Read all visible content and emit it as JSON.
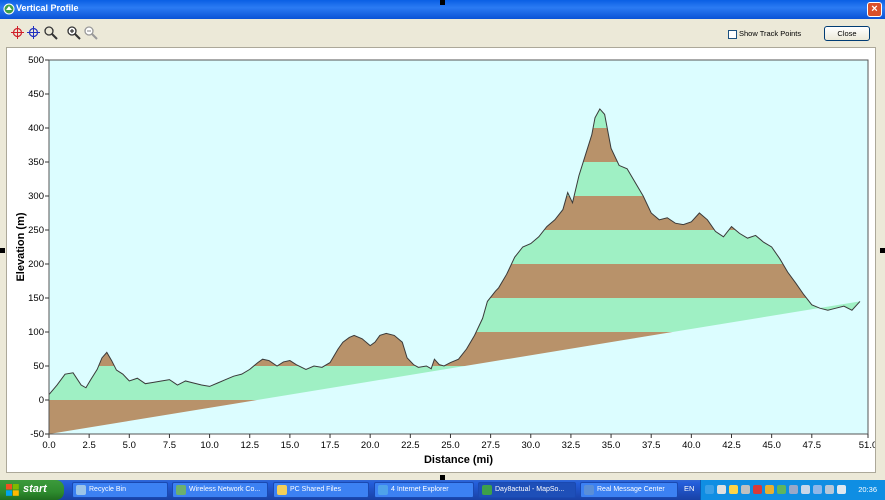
{
  "window": {
    "title": "Vertical Profile"
  },
  "toolbar": {
    "show_track_points_label": "Show Track Points",
    "show_track_points_checked": false,
    "close_label": "Close",
    "tools": [
      "pan-crosshair-icon",
      "center-crosshair-icon",
      "zoom-box-icon",
      "zoom-in-icon",
      "zoom-out-icon"
    ]
  },
  "chart_data": {
    "type": "area",
    "xlabel": "Distance   (mi)",
    "ylabel": "Elevation  (m)",
    "xlim": [
      0,
      51
    ],
    "ylim": [
      -50,
      500
    ],
    "xticks": [
      "0.0",
      "2.5",
      "5.0",
      "7.5",
      "10.0",
      "12.5",
      "15.0",
      "17.5",
      "20.0",
      "22.5",
      "25.0",
      "27.5",
      "30.0",
      "32.5",
      "35.0",
      "37.5",
      "40.0",
      "42.5",
      "45.0",
      "47.5",
      "51.0"
    ],
    "yticks": [
      "-50",
      "0",
      "50",
      "100",
      "150",
      "200",
      "250",
      "300",
      "350",
      "400",
      "450",
      "500"
    ],
    "band_colors": [
      "#b8926a",
      "#9ff0c4"
    ],
    "background": "#dcfdff",
    "line_color": "#3a3a3a",
    "x": [
      0,
      0.5,
      1,
      1.5,
      2,
      2.3,
      2.6,
      3,
      3.3,
      3.6,
      3.9,
      4.2,
      4.6,
      5,
      5.5,
      6,
      6.5,
      7,
      7.5,
      8,
      8.5,
      9,
      9.5,
      10,
      10.5,
      11,
      11.5,
      12,
      12.5,
      13,
      13.3,
      13.7,
      14.2,
      14.6,
      15,
      15.4,
      16,
      16.5,
      17,
      17.5,
      18,
      18.3,
      18.7,
      19,
      19.5,
      20,
      20.3,
      20.6,
      21,
      21.5,
      22,
      22.3,
      22.7,
      23,
      23.5,
      23.8,
      24,
      24.3,
      24.6,
      25,
      25.5,
      26,
      26.5,
      27,
      27.3,
      27.8,
      28,
      28.5,
      29,
      29.5,
      30,
      30.5,
      31,
      31.5,
      32,
      32.3,
      32.6,
      33,
      33.4,
      33.8,
      34,
      34.3,
      34.6,
      35,
      35.5,
      36,
      36.5,
      37,
      37.5,
      38,
      38.5,
      39,
      39.5,
      40,
      40.5,
      41,
      41.5,
      42,
      42.5,
      43,
      43.5,
      44,
      44.5,
      45,
      45.5,
      46,
      46.5,
      47,
      47.5,
      48,
      48.5,
      49,
      49.5,
      50,
      50.5,
      51
    ],
    "y": [
      8,
      22,
      38,
      40,
      22,
      18,
      30,
      45,
      62,
      70,
      58,
      44,
      38,
      28,
      32,
      24,
      26,
      28,
      30,
      22,
      28,
      25,
      22,
      20,
      25,
      30,
      35,
      38,
      45,
      55,
      60,
      58,
      50,
      56,
      58,
      52,
      45,
      50,
      48,
      55,
      75,
      85,
      92,
      95,
      90,
      80,
      85,
      95,
      98,
      95,
      85,
      62,
      52,
      48,
      50,
      46,
      60,
      52,
      50,
      55,
      60,
      75,
      95,
      120,
      145,
      160,
      165,
      185,
      210,
      225,
      230,
      240,
      255,
      265,
      280,
      305,
      290,
      330,
      360,
      390,
      415,
      428,
      420,
      370,
      345,
      340,
      320,
      300,
      275,
      265,
      268,
      260,
      258,
      262,
      275,
      265,
      248,
      240,
      255,
      245,
      238,
      242,
      232,
      225,
      208,
      188,
      172,
      155,
      140,
      135,
      132,
      135,
      138,
      132,
      145
    ],
    "title": ""
  },
  "taskbar": {
    "start_label": "start",
    "tasks": [
      {
        "label": "Recycle Bin",
        "active": false
      },
      {
        "label": "Wireless Network Co...",
        "active": false
      },
      {
        "label": "PC Shared Files",
        "active": false
      },
      {
        "label": "4 Internet Explorer",
        "active": false
      },
      {
        "label": "Day8actual - MapSo...",
        "active": true
      },
      {
        "label": "Real Message Center",
        "active": false
      }
    ],
    "language": "EN",
    "clock": "20:36"
  }
}
